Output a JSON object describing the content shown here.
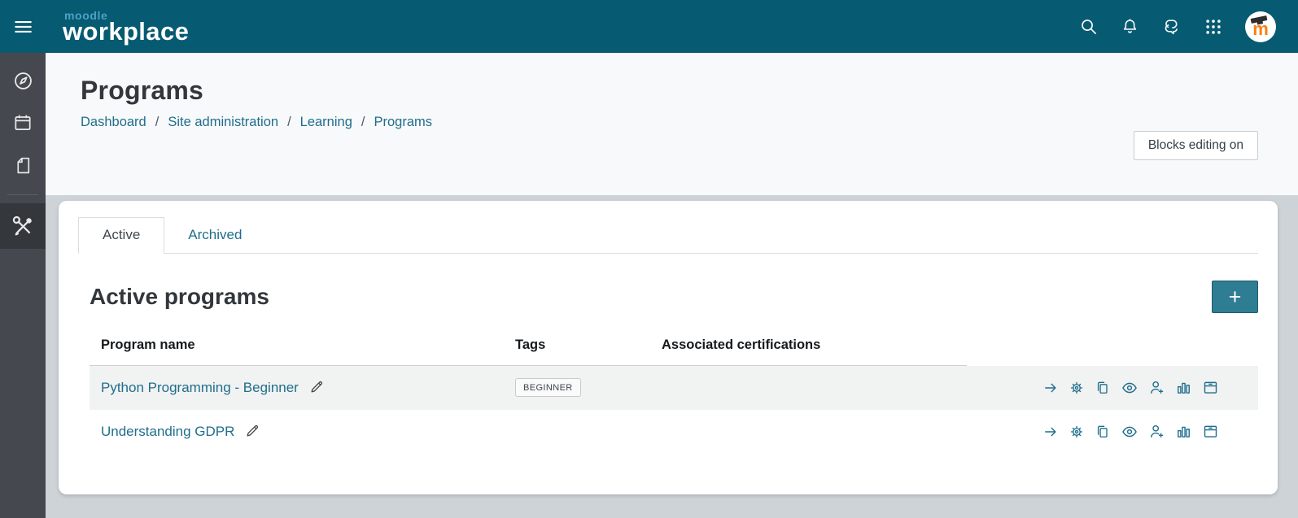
{
  "topbar": {
    "logo_small": "moodle",
    "logo_large": "workplace",
    "icons": [
      "menu-icon",
      "search-icon",
      "notifications-icon",
      "messages-icon",
      "app-launcher-icon",
      "avatar"
    ],
    "avatar_letter": "m"
  },
  "sidebar": {
    "items": [
      {
        "name": "dashboard",
        "icon": "compass-icon",
        "active": false
      },
      {
        "name": "calendar",
        "icon": "calendar-icon",
        "active": false
      },
      {
        "name": "courses",
        "icon": "file-icon",
        "active": false
      },
      {
        "name": "site-administration",
        "icon": "tools-icon",
        "active": true
      }
    ]
  },
  "header": {
    "title": "Programs",
    "breadcrumb": [
      "Dashboard",
      "Site administration",
      "Learning",
      "Programs"
    ],
    "separator": "/",
    "blocks_editing_button": "Blocks editing on"
  },
  "tabs": {
    "active_tab": "Active",
    "archived_tab": "Archived"
  },
  "main": {
    "heading": "Active programs",
    "add_button_label": "+",
    "table": {
      "columns": [
        "Program name",
        "Tags",
        "Associated certifications"
      ],
      "rows": [
        {
          "name": "Python Programming - Beginner",
          "tag": "BEGINNER",
          "certifications": ""
        },
        {
          "name": "Understanding GDPR",
          "tag": "",
          "certifications": ""
        }
      ],
      "row_action_icons": [
        "arrow-right",
        "settings-gear",
        "duplicate",
        "preview-eye",
        "assign-users",
        "report-chart",
        "archive-box"
      ]
    }
  },
  "colors": {
    "topbar": "#065a71",
    "link": "#1f6e8c",
    "accent_button": "#2e7d93",
    "sidebar": "#45494f",
    "sidebar_active": "#34383d",
    "moodle_orange": "#f98012",
    "row_alt": "#f1f2f2",
    "content_bg": "#ced3d7"
  }
}
